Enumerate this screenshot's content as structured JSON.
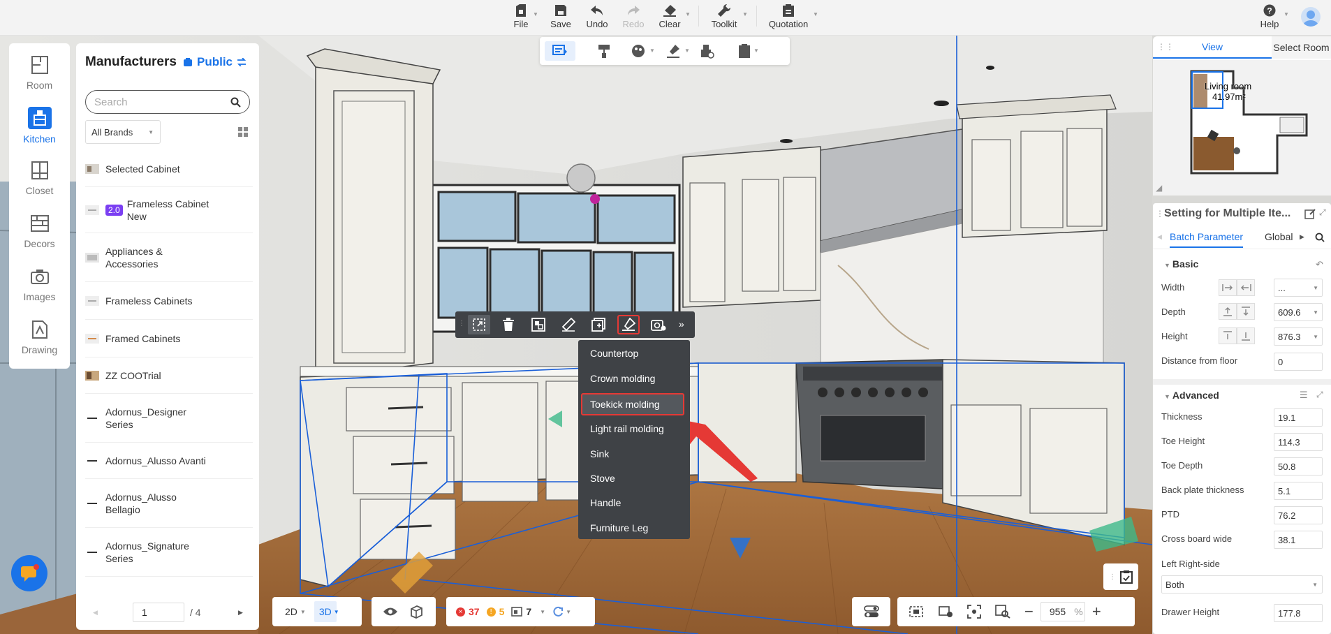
{
  "toolbar": {
    "file": "File",
    "save": "Save",
    "undo": "Undo",
    "redo": "Redo",
    "clear": "Clear",
    "toolkit": "Toolkit",
    "quotation": "Quotation",
    "help": "Help"
  },
  "leftnav": {
    "items": [
      {
        "label": "Room",
        "icon": "room-icon"
      },
      {
        "label": "Kitchen",
        "icon": "kitchen-icon",
        "active": true
      },
      {
        "label": "Closet",
        "icon": "closet-icon"
      },
      {
        "label": "Decors",
        "icon": "decors-icon"
      },
      {
        "label": "Images",
        "icon": "camera-icon"
      },
      {
        "label": "Drawing",
        "icon": "drawing-icon"
      }
    ]
  },
  "manufacturers": {
    "title": "Manufacturers",
    "scope": "Public",
    "search_placeholder": "Search",
    "brand_filter": "All Brands",
    "items": [
      {
        "label": "Selected Cabinet"
      },
      {
        "label": "Frameless Cabinet New",
        "badge": "2.0"
      },
      {
        "label": "Appliances & Accessories"
      },
      {
        "label": "Frameless Cabinets"
      },
      {
        "label": "Framed Cabinets"
      },
      {
        "label": "ZZ COOTrial"
      },
      {
        "label": "Adornus_Designer Series"
      },
      {
        "label": "Adornus_Alusso Avanti"
      },
      {
        "label": "Adornus_Alusso Bellagio"
      },
      {
        "label": "Adornus_Signature Series"
      }
    ],
    "page": "1",
    "page_total": "/ 4"
  },
  "context_menu": {
    "items": [
      "Countertop",
      "Crown molding",
      "Toekick molding",
      "Light rail molding",
      "Sink",
      "Stove",
      "Handle",
      "Furniture Leg"
    ],
    "highlighted": "Toekick molding"
  },
  "view_panel": {
    "tabs": [
      "View",
      "Select Room"
    ],
    "room_name": "Living room",
    "room_area": "41.97m²"
  },
  "settings": {
    "title": "Setting for Multiple Ite...",
    "tabs": [
      "Batch Parameter",
      "Global"
    ],
    "basic": {
      "label": "Basic",
      "width_label": "Width",
      "width_value": "...",
      "depth_label": "Depth",
      "depth_value": "609.6",
      "height_label": "Height",
      "height_value": "876.3",
      "floor_label": "Distance from floor",
      "floor_value": "0"
    },
    "advanced": {
      "label": "Advanced",
      "rows": [
        {
          "label": "Thickness",
          "value": "19.1"
        },
        {
          "label": "Toe Height",
          "value": "114.3"
        },
        {
          "label": "Toe Depth",
          "value": "50.8"
        },
        {
          "label": "Back plate thickness",
          "value": "5.1"
        },
        {
          "label": "PTD",
          "value": "76.2"
        },
        {
          "label": "Cross board wide",
          "value": "38.1"
        }
      ],
      "side_label": "Left Right-side",
      "side_value": "Both",
      "drawer_label": "Drawer Height",
      "drawer_value": "177.8"
    }
  },
  "bottombar": {
    "mode_2d": "2D",
    "mode_3d": "3D",
    "errors": "37",
    "warnings": "5",
    "items": "7",
    "zoom": "955",
    "zoom_unit": "%"
  },
  "colors": {
    "accent": "#1a73e8",
    "menu_bg": "#3f4246",
    "highlight": "#e53935",
    "badge": "#7b3ff2"
  }
}
